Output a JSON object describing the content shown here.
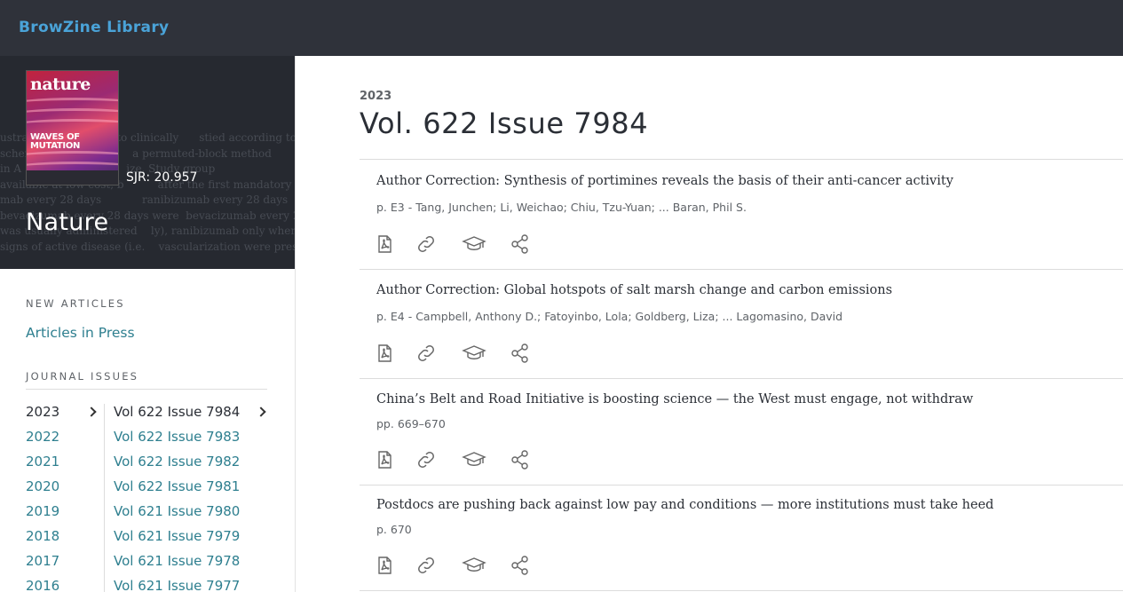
{
  "app": {
    "brand": "BrowZine Library"
  },
  "journal": {
    "title": "Nature",
    "sjr": "SJR: 20.957",
    "cover": {
      "masthead": "nature",
      "headline_line1": "WAVES OF",
      "headline_line2": "MUTATION"
    }
  },
  "sidebar": {
    "new_articles_label": "NEW ARTICLES",
    "articles_in_press": "Articles in Press",
    "journal_issues_label": "JOURNAL ISSUES",
    "years": [
      "2023",
      "2022",
      "2021",
      "2020",
      "2019",
      "2018",
      "2017",
      "2016"
    ],
    "issues": [
      "Vol 622 Issue 7984",
      "Vol 622 Issue 7983",
      "Vol 622 Issue 7982",
      "Vol 622 Issue 7981",
      "Vol 621 Issue 7980",
      "Vol 621 Issue 7979",
      "Vol 621 Issue 7978",
      "Vol 621 Issue 7977"
    ],
    "selected_year": "2023",
    "selected_issue": "Vol 622 Issue 7984"
  },
  "main": {
    "year": "2023",
    "issue_title": "Vol. 622 Issue 7984",
    "articles": [
      {
        "title": "Author Correction: Synthesis of portimines reveals the basis of their anti-cancer activity",
        "meta": "p. E3  -  Tang, Junchen; Li, Weichao; Chiu, Tzu-Yuan; ... Baran, Phil S."
      },
      {
        "title": "Author Correction: Global hotspots of salt marsh change and carbon emissions",
        "meta": "p. E4  -  Campbell, Anthony D.; Fatoyinbo, Lola; Goldberg, Liza; ... Lagomasino, David"
      },
      {
        "title": "China’s Belt and Road Initiative is boosting science — the West must engage, not withdraw",
        "meta": "pp. 669–670"
      },
      {
        "title": "Postdocs are pushing back against low pay and conditions — more institutions must take heed",
        "meta": "p. 670"
      }
    ]
  },
  "colors": {
    "topbar": "#2f323a",
    "brand": "#4aa3d8",
    "link": "#2e7f8f",
    "hero": "#262930"
  },
  "icons": [
    "pdf-icon",
    "link-icon",
    "graduation-cap-icon",
    "share-icon"
  ]
}
